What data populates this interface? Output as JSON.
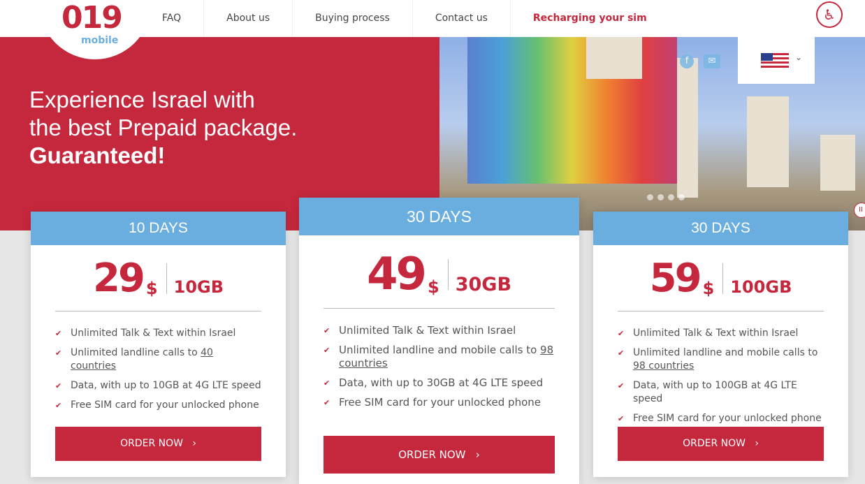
{
  "logo": {
    "number": "019",
    "sub": "mobile"
  },
  "nav": [
    "FAQ",
    "About us",
    "Buying process",
    "Contact us",
    "Recharging your sim"
  ],
  "hero": {
    "line1": "Experience Israel with",
    "line2": "the best Prepaid package.",
    "line3": "Guaranteed!"
  },
  "language": {
    "selected": "English (US flag)"
  },
  "social": [
    "facebook-icon",
    "mail-icon"
  ],
  "colors": {
    "brand_red": "#c5283d",
    "accent_blue": "#6aaee0"
  },
  "cards": [
    {
      "title": "10 DAYS",
      "price": "29",
      "currency": "$",
      "data": "10GB",
      "features": [
        "Unlimited Talk & Text within Israel",
        "Unlimited landline calls to ",
        "Data, with up to 10GB at 4G LTE speed",
        "Free SIM card for your unlocked phone"
      ],
      "link": "40 countries",
      "button": "ORDER NOW"
    },
    {
      "title": "30 DAYS",
      "price": "49",
      "currency": "$",
      "data": "30GB",
      "features": [
        "Unlimited Talk & Text within Israel",
        "Unlimited landline and mobile calls to ",
        "Data, with up to 30GB at 4G LTE speed",
        "Free SIM card for your unlocked phone"
      ],
      "link": "98 countries",
      "button": "ORDER NOW"
    },
    {
      "title": "30 DAYS",
      "price": "59",
      "currency": "$",
      "data": "100GB",
      "features": [
        "Unlimited Talk & Text within Israel",
        "Unlimited landline and mobile calls to ",
        "Data, with up to 100GB at 4G LTE speed",
        "Free SIM card for your unlocked phone"
      ],
      "link": "98 countries",
      "button": "ORDER NOW"
    }
  ]
}
